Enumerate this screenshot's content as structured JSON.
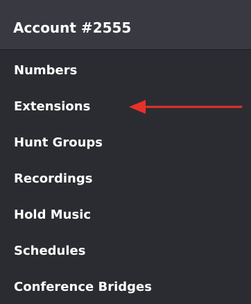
{
  "account": {
    "title": "Account #2555"
  },
  "menu": {
    "items": [
      {
        "label": "Numbers"
      },
      {
        "label": "Extensions"
      },
      {
        "label": "Hunt Groups"
      },
      {
        "label": "Recordings"
      },
      {
        "label": "Hold Music"
      },
      {
        "label": "Schedules"
      },
      {
        "label": "Conference Bridges"
      }
    ]
  },
  "colors": {
    "panel_background": "#2b2c31",
    "header_background": "#383941",
    "text": "#ffffff",
    "annotation_arrow": "#e8312a"
  },
  "annotation": {
    "icon": "left-arrow-icon",
    "target": "Extensions"
  }
}
